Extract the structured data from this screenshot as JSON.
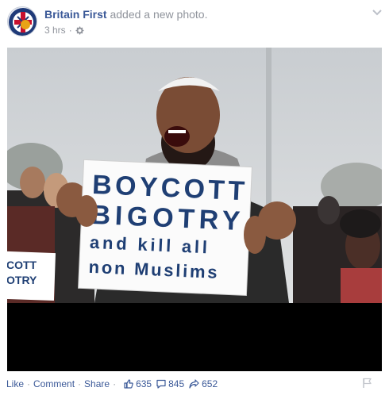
{
  "post": {
    "author": "Britain First",
    "action": "added a new photo.",
    "time": "3 hrs",
    "privacy_icon": "gear-icon",
    "menu_icon": "chevron-down-icon"
  },
  "photo": {
    "sign_lines": [
      "BOYCOTT",
      "BIGOTRY",
      "and kill all",
      "non Muslims"
    ],
    "side_sign_lines": [
      "COTT",
      "OTRY"
    ]
  },
  "footer": {
    "like": "Like",
    "comment": "Comment",
    "share": "Share",
    "likes_count": "635",
    "comments_count": "845",
    "shares_count": "652",
    "flag_icon": "flag-icon"
  },
  "colors": {
    "link": "#3b5998",
    "meta": "#90949c",
    "sign_text": "#1f3f74"
  }
}
